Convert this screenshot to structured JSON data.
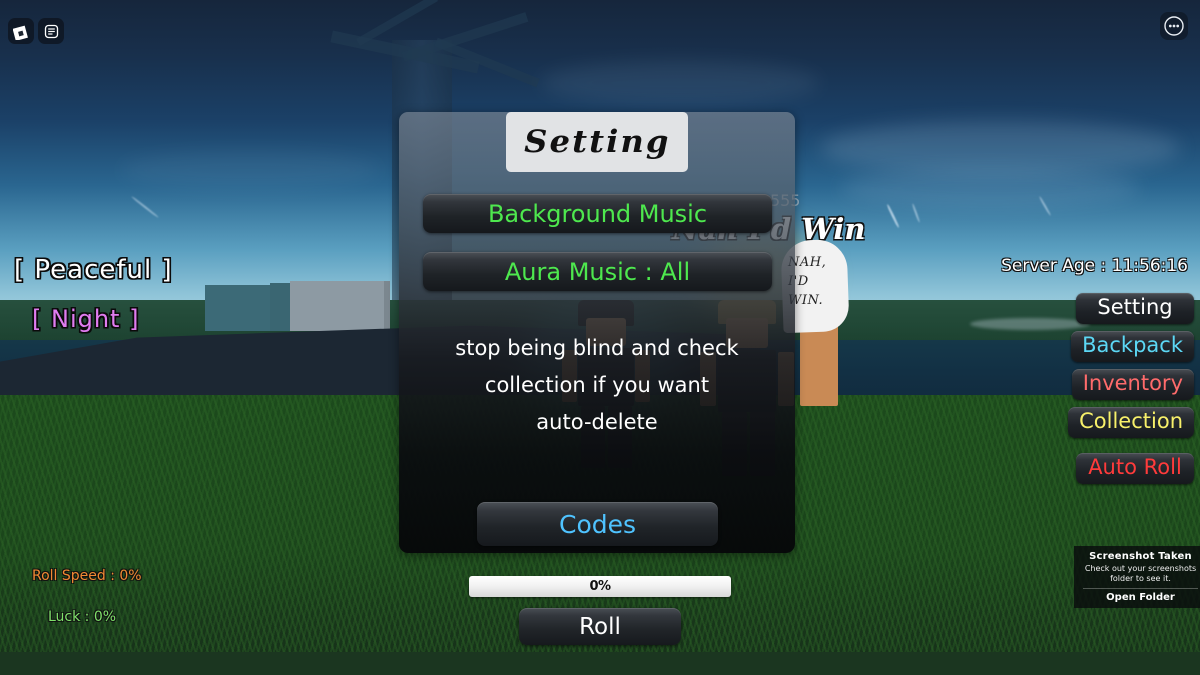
{
  "top_bar": {
    "roblox_logo": "roblox-logo-icon",
    "chat_icon": "chat-icon",
    "more_icon": "more-horizontal-icon"
  },
  "hud": {
    "biome_tag": "[ Peaceful ]",
    "time_tag": "[ Night ]",
    "server_age": "Server Age : 11:56:16",
    "roll_speed": "Roll Speed : 0%",
    "luck": "Luck : 0%"
  },
  "right_menu": {
    "items": [
      {
        "label": "Setting",
        "color": "#ffffff"
      },
      {
        "label": "Backpack",
        "color": "#5cd8f5"
      },
      {
        "label": "Inventory",
        "color": "#ff6b6b"
      },
      {
        "label": "Collection",
        "color": "#f7f06a"
      },
      {
        "label": "Auto Roll",
        "color": "#ff3b3b"
      }
    ]
  },
  "settings_panel": {
    "title": "Setting",
    "buttons": [
      {
        "label": "Background Music"
      },
      {
        "label": "Aura Music : All"
      }
    ],
    "note_lines": [
      "stop being blind and check",
      "collection if you want",
      "auto-delete"
    ],
    "codes_label": "Codes"
  },
  "aura_overlay": {
    "rarity": "1 in 555",
    "title": "Nah I'd Win",
    "speech_lines": [
      "NAH,",
      "I'D",
      "WIN."
    ]
  },
  "bottom_bar": {
    "progress_value": "0%",
    "roll_label": "Roll"
  },
  "screenshot_toast": {
    "title": "Screenshot Taken",
    "body": "Check out your screenshots folder to see it.",
    "action": "Open Folder"
  },
  "colors": {
    "accent_green": "#4ee84e",
    "accent_blue": "#4fc3ff",
    "night_purple": "#e07cf0",
    "roll_speed_orange": "#f08a33",
    "luck_green": "#7fe06a"
  }
}
